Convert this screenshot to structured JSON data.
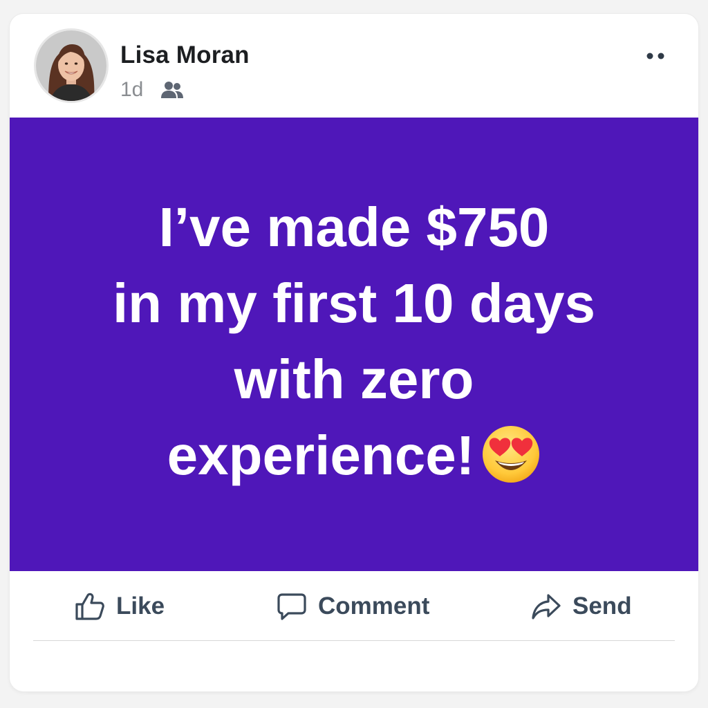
{
  "post": {
    "author": {
      "name": "Lisa Moran",
      "avatar_icon": "profile-photo"
    },
    "time": "1d",
    "audience_icon": "friends-icon",
    "more_icon": "more-options-icon",
    "background_color": "#4f17b9",
    "text_lines": [
      "I’ve made $750",
      "in my first 10 days",
      "with zero",
      "experience!"
    ],
    "emoji": "heart-eyes-emoji"
  },
  "actions": {
    "like_label": "Like",
    "comment_label": "Comment",
    "send_label": "Send"
  }
}
